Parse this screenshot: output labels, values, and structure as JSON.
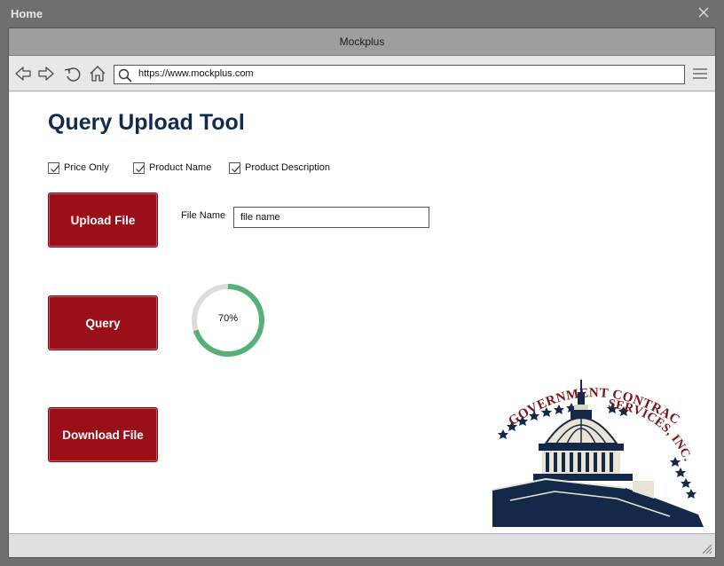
{
  "window": {
    "title": "Home"
  },
  "browser": {
    "tab_title": "Mockplus",
    "url": "https://www.mockplus.com"
  },
  "page": {
    "title": "Query Upload Tool",
    "checkboxes": [
      {
        "label": "Price Only",
        "checked": true
      },
      {
        "label": "Product Name",
        "checked": true
      },
      {
        "label": "Product Description",
        "checked": true
      }
    ],
    "upload_button": "Upload File",
    "file_name_label": "File Name",
    "file_name_value": "file name",
    "query_button": "Query",
    "progress": {
      "value": 0.7,
      "label": "70%"
    },
    "download_button": "Download File",
    "logo": {
      "text_line1": "GOVERNMENT CONTRACT",
      "text_line2": "SERVICES, INC."
    }
  },
  "colors": {
    "button": "#9b0f18",
    "title": "#132a4a",
    "progress": "#57b07a",
    "progress_track": "#dcdcdc"
  }
}
